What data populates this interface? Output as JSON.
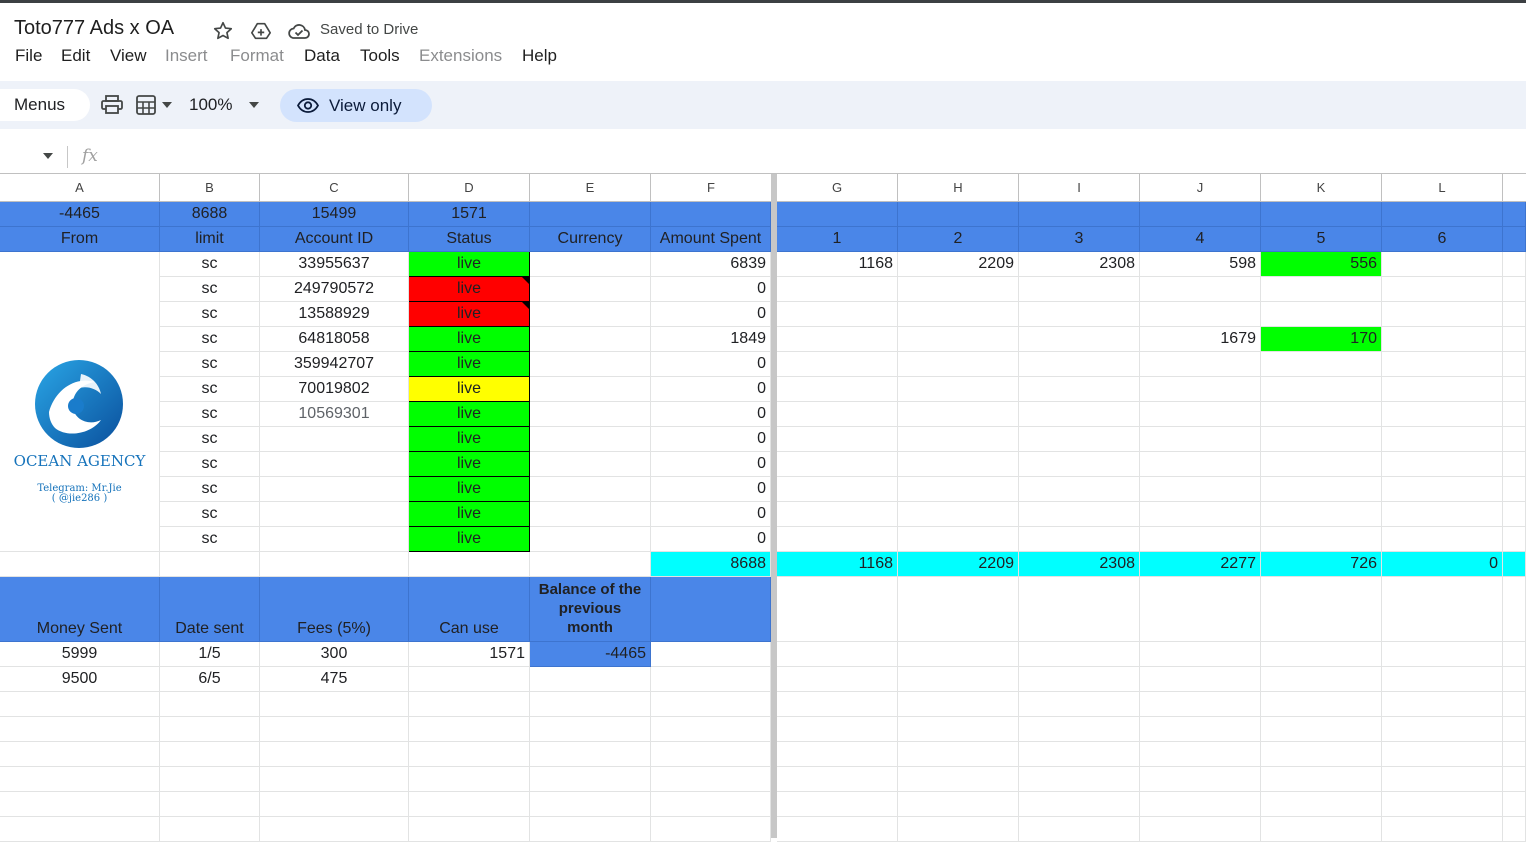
{
  "doc": {
    "title": "Toto777 Ads x OA",
    "saved_status": "Saved to Drive"
  },
  "menu": [
    "File",
    "Edit",
    "View",
    "Insert",
    "Format",
    "Data",
    "Tools",
    "Extensions",
    "Help"
  ],
  "toolbar": {
    "menus_label": "Menus",
    "zoom": "100%",
    "view_only_label": "View only"
  },
  "formula_bar": {
    "fx": "fx"
  },
  "columns": [
    "A",
    "B",
    "C",
    "D",
    "E",
    "F",
    "G",
    "H",
    "I",
    "J",
    "K",
    "L"
  ],
  "sheet": {
    "row_totals": [
      "-4465",
      "8688",
      "15499",
      "1571"
    ],
    "headers": [
      "From",
      "limit",
      "Account ID",
      "Status",
      "Currency",
      "Amount Spent",
      "1",
      "2",
      "3",
      "4",
      "5",
      "6"
    ],
    "accounts": [
      {
        "limit": "sc",
        "id": "33955637",
        "status": "live",
        "status_color": "#00ff00",
        "spent": "6839"
      },
      {
        "limit": "sc",
        "id": "249790572",
        "status": "live",
        "status_color": "#ff0000",
        "spent": "0"
      },
      {
        "limit": "sc",
        "id": "13588929",
        "status": "live",
        "status_color": "#ff0000",
        "spent": "0"
      },
      {
        "limit": "sc",
        "id": "64818058",
        "status": "live",
        "status_color": "#00ff00",
        "spent": "1849"
      },
      {
        "limit": "sc",
        "id": "359942707",
        "status": "live",
        "status_color": "#00ff00",
        "spent": "0"
      },
      {
        "limit": "sc",
        "id": "70019802",
        "status": "live",
        "status_color": "#ffff00",
        "spent": "0"
      },
      {
        "limit": "sc",
        "id": "10569301",
        "status": "live",
        "status_color": "#00ff00",
        "spent": "0"
      },
      {
        "limit": "sc",
        "id": "",
        "status": "live",
        "status_color": "#00ff00",
        "spent": "0"
      },
      {
        "limit": "sc",
        "id": "",
        "status": "live",
        "status_color": "#00ff00",
        "spent": "0"
      },
      {
        "limit": "sc",
        "id": "",
        "status": "live",
        "status_color": "#00ff00",
        "spent": "0"
      },
      {
        "limit": "sc",
        "id": "",
        "status": "live",
        "status_color": "#00ff00",
        "spent": "0"
      },
      {
        "limit": "sc",
        "id": "",
        "status": "live",
        "status_color": "#00ff00",
        "spent": "0"
      }
    ],
    "daily": {
      "row1": [
        "1168",
        "2209",
        "2308",
        "598",
        "556",
        ""
      ],
      "row4": [
        "",
        "",
        "",
        "1679",
        "170",
        ""
      ]
    },
    "totals_row": [
      "8688",
      "1168",
      "2209",
      "2308",
      "2277",
      "726",
      "0"
    ],
    "payments_headers": [
      "Money Sent",
      "Date sent",
      "Fees (5%)",
      "Can use",
      "Balance of the previous month"
    ],
    "payments": [
      {
        "sent": "5999",
        "date": "1/5",
        "fee": "300",
        "use": "1571",
        "balance": "-4465"
      },
      {
        "sent": "9500",
        "date": "6/5",
        "fee": "475",
        "use": "",
        "balance": ""
      }
    ]
  },
  "logo": {
    "name": "OCEAN AGENCY",
    "telegram": "Telegram: Mr.Jie",
    "handle": "( @jie286 )"
  }
}
